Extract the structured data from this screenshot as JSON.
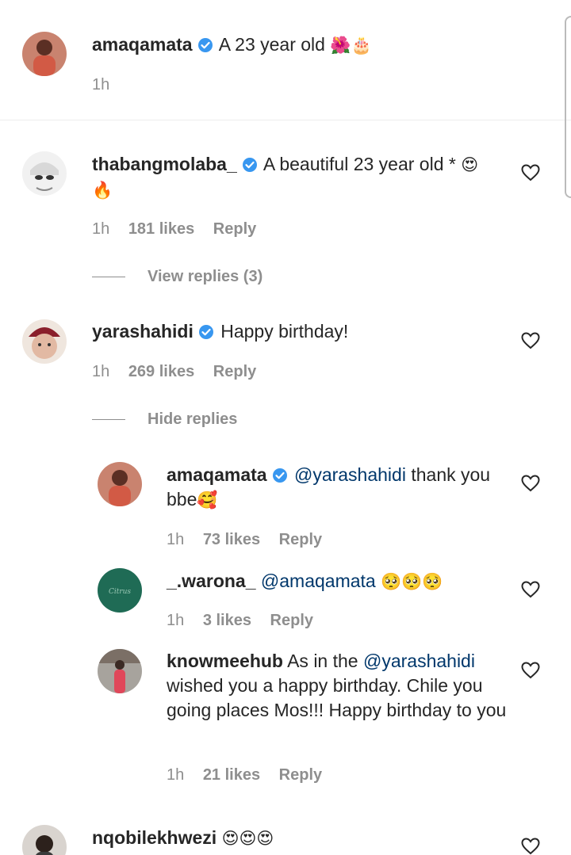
{
  "caption": {
    "username": "amaqamata",
    "text": "A 23 year old",
    "emoji": "🌺🎂",
    "time": "1h"
  },
  "comments": [
    {
      "username": "thabangmolaba_",
      "text": "A beautiful 23 year old *",
      "emoji": "😍",
      "emoji2": "🔥",
      "time": "1h",
      "likes": "181 likes",
      "reply": "Reply",
      "toggle": "View replies (3)"
    },
    {
      "username": "yarashahidi",
      "text": "Happy birthday!",
      "time": "1h",
      "likes": "269 likes",
      "reply": "Reply",
      "toggle": "Hide replies"
    }
  ],
  "replies": [
    {
      "username": "amaqamata",
      "mention": "@yarashahidi",
      "text": " thank you bbe",
      "emoji": "🥰",
      "time": "1h",
      "likes": "73 likes",
      "reply": "Reply"
    },
    {
      "username": "_.warona_",
      "mention": "@amaqamata",
      "emoji": "🥺🥺🥺",
      "time": "1h",
      "likes": "3 likes",
      "reply": "Reply"
    },
    {
      "username": "knowmeehub",
      "text_pre": "As in the ",
      "mention": "@yarashahidi",
      "text_post": " wished you a happy birthday. Chile you going places Mos!!! Happy birthday to you",
      "time": "1h",
      "likes": "21 likes",
      "reply": "Reply"
    }
  ],
  "last": {
    "username": "nqobilekhwezi",
    "emoji": "😍😍😍"
  },
  "colors": {
    "verified": "#3897f0",
    "mention": "#00376b",
    "meta": "#8e8e8e"
  }
}
